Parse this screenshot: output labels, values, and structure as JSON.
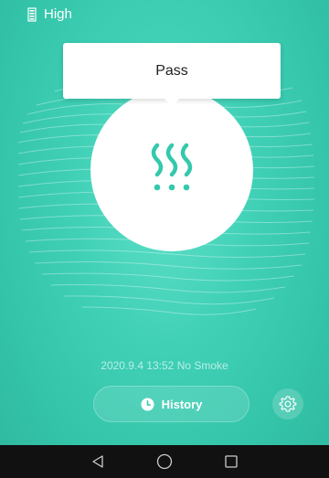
{
  "status_bar": {
    "level_text": "High",
    "battery_icon": "battery-icon"
  },
  "toast": {
    "message": "Pass"
  },
  "center": {
    "icon": "smoke-icon"
  },
  "record": {
    "text": "2020.9.4 13:52 No Smoke"
  },
  "history_button": {
    "label": "History",
    "icon": "clock-icon"
  },
  "settings_button": {
    "icon": "gear-icon"
  },
  "nav": {
    "back": "back-triangle-icon",
    "home": "home-circle-icon",
    "recents": "recents-square-icon"
  },
  "colors": {
    "background": "#3fd0b6",
    "accent": "#2fb89f",
    "nav": "#111111"
  }
}
